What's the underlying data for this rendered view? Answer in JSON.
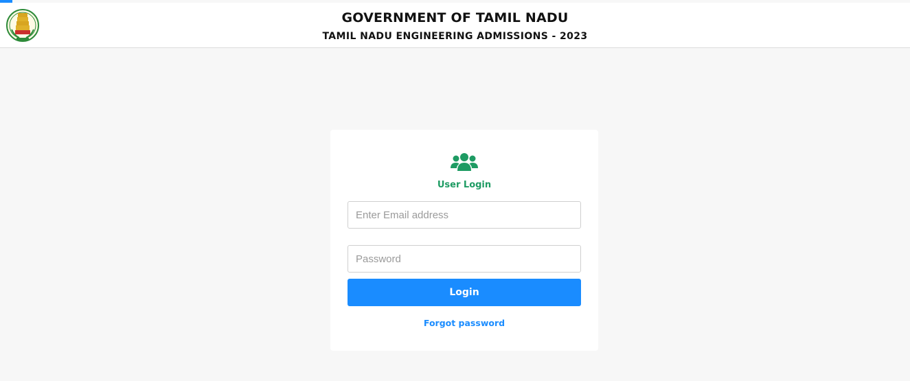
{
  "header": {
    "government_title": "GOVERNMENT OF TAMIL NADU",
    "subtitle": "TAMIL NADU ENGINEERING ADMISSIONS - 2023",
    "emblem_icon": "tamil-nadu-emblem-icon"
  },
  "login": {
    "icon": "users-icon",
    "title": "User Login",
    "email_placeholder": "Enter Email address",
    "email_value": "",
    "password_placeholder": "Password",
    "password_value": "",
    "login_label": "Login",
    "forgot_label": "Forgot password"
  },
  "colors": {
    "accent_blue": "#1a8cff",
    "brand_green": "#1e9b63",
    "page_background": "#f7f7f7"
  }
}
